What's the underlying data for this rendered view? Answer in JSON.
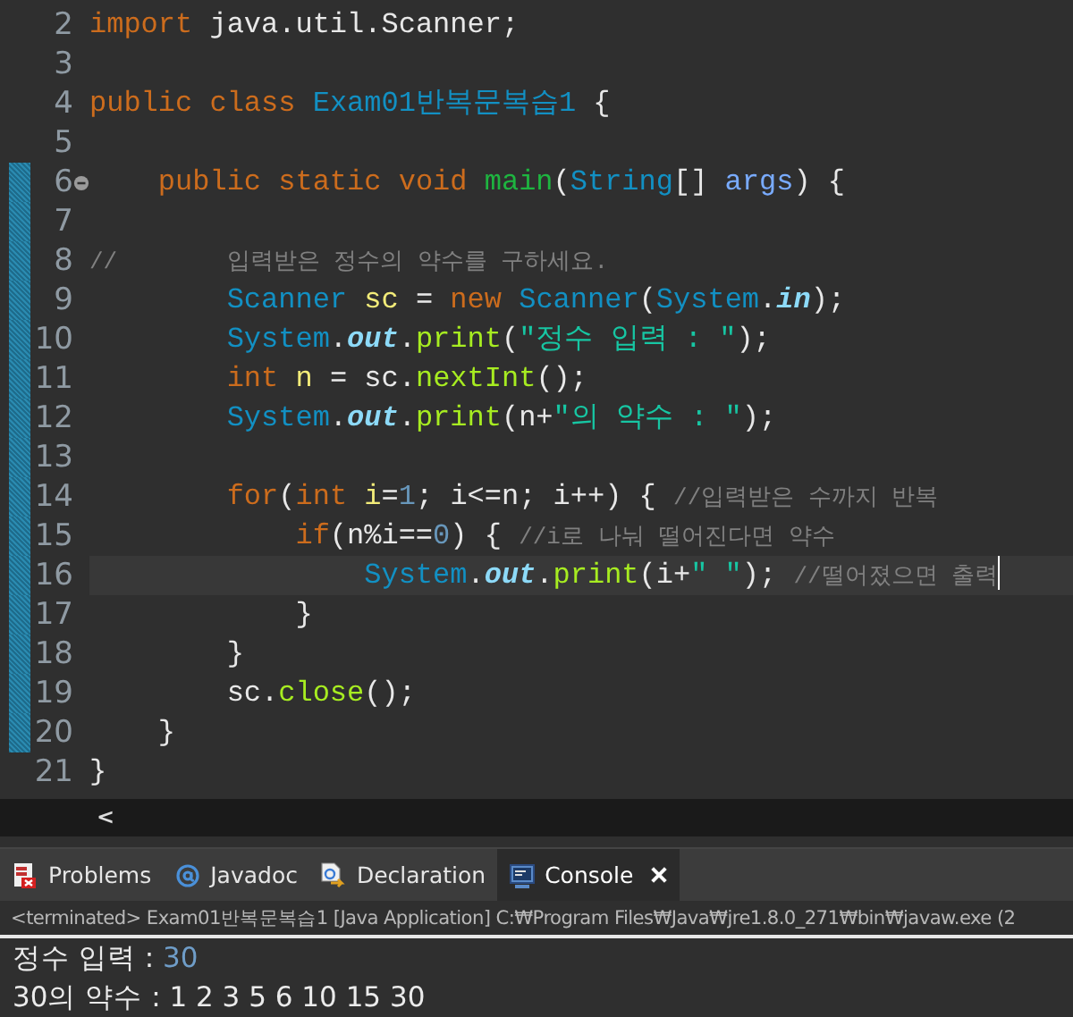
{
  "editor": {
    "lines": [
      {
        "num": "2",
        "changed": false,
        "current": false,
        "fold": false,
        "tokens": [
          {
            "kind": "kw",
            "text": "import"
          },
          {
            "kind": "plain",
            "text": " java.util.Scanner;"
          }
        ]
      },
      {
        "num": "3",
        "changed": false,
        "current": false,
        "fold": false
      },
      {
        "num": "4",
        "changed": false,
        "current": false,
        "fold": false,
        "tokens": [
          {
            "kind": "kw",
            "text": "public "
          },
          {
            "kind": "kw",
            "text": "class "
          },
          {
            "kind": "type",
            "text": "Exam01반복문복습1"
          },
          {
            "kind": "plain",
            "text": " {"
          }
        ]
      },
      {
        "num": "5",
        "changed": false,
        "current": false,
        "fold": false
      },
      {
        "num": "6",
        "changed": true,
        "current": false,
        "fold": true,
        "tokens": [
          {
            "kind": "kw",
            "text": "\tpublic "
          },
          {
            "kind": "kw",
            "text": "static "
          },
          {
            "kind": "kw",
            "text": "void "
          },
          {
            "kind": "decl",
            "text": "main"
          },
          {
            "kind": "plain",
            "text": "("
          },
          {
            "kind": "type",
            "text": "String"
          },
          {
            "kind": "plain",
            "text": "[] "
          },
          {
            "kind": "param",
            "text": "args"
          },
          {
            "kind": "plain",
            "text": ") {"
          }
        ]
      },
      {
        "num": "7",
        "changed": true,
        "current": false,
        "fold": false
      },
      {
        "num": "8",
        "changed": true,
        "current": false,
        "fold": false,
        "tokens": [
          {
            "kind": "comment",
            "text": "//\t\t입력받은 정수의 약수를 구하세요."
          }
        ]
      },
      {
        "num": "9",
        "changed": true,
        "current": false,
        "fold": false,
        "tokens": [
          {
            "kind": "type",
            "text": "\t\tScanner "
          },
          {
            "kind": "var",
            "text": "sc"
          },
          {
            "kind": "plain",
            "text": " = "
          },
          {
            "kind": "kw",
            "text": "new "
          },
          {
            "kind": "type",
            "text": "Scanner"
          },
          {
            "kind": "plain",
            "text": "("
          },
          {
            "kind": "type",
            "text": "System"
          },
          {
            "kind": "plain",
            "text": "."
          },
          {
            "kind": "field",
            "text": "in"
          },
          {
            "kind": "plain",
            "text": ");"
          }
        ]
      },
      {
        "num": "10",
        "changed": true,
        "current": false,
        "fold": false,
        "tokens": [
          {
            "kind": "type",
            "text": "\t\tSystem"
          },
          {
            "kind": "plain",
            "text": "."
          },
          {
            "kind": "field",
            "text": "out"
          },
          {
            "kind": "plain",
            "text": "."
          },
          {
            "kind": "method",
            "text": "print"
          },
          {
            "kind": "plain",
            "text": "("
          },
          {
            "kind": "str",
            "text": "\"정수 입력 : \""
          },
          {
            "kind": "plain",
            "text": ");"
          }
        ]
      },
      {
        "num": "11",
        "changed": true,
        "current": false,
        "fold": false,
        "tokens": [
          {
            "kind": "kw",
            "text": "\t\tint "
          },
          {
            "kind": "var",
            "text": "n"
          },
          {
            "kind": "plain",
            "text": " = sc."
          },
          {
            "kind": "method",
            "text": "nextInt"
          },
          {
            "kind": "plain",
            "text": "();"
          }
        ]
      },
      {
        "num": "12",
        "changed": true,
        "current": false,
        "fold": false,
        "tokens": [
          {
            "kind": "type",
            "text": "\t\tSystem"
          },
          {
            "kind": "plain",
            "text": "."
          },
          {
            "kind": "field",
            "text": "out"
          },
          {
            "kind": "plain",
            "text": "."
          },
          {
            "kind": "method",
            "text": "print"
          },
          {
            "kind": "plain",
            "text": "(n+"
          },
          {
            "kind": "str",
            "text": "\"의 약수 : \""
          },
          {
            "kind": "plain",
            "text": ");"
          }
        ]
      },
      {
        "num": "13",
        "changed": true,
        "current": false,
        "fold": false
      },
      {
        "num": "14",
        "changed": true,
        "current": false,
        "fold": false,
        "tokens": [
          {
            "kind": "kw",
            "text": "\t\tfor"
          },
          {
            "kind": "plain",
            "text": "("
          },
          {
            "kind": "kw",
            "text": "int "
          },
          {
            "kind": "var",
            "text": "i"
          },
          {
            "kind": "plain",
            "text": "="
          },
          {
            "kind": "num",
            "text": "1"
          },
          {
            "kind": "plain",
            "text": "; i<=n; i++) { "
          },
          {
            "kind": "comment",
            "text": "//입력받은 수까지 반복"
          }
        ]
      },
      {
        "num": "15",
        "changed": true,
        "current": false,
        "fold": false,
        "tokens": [
          {
            "kind": "kw",
            "text": "\t\t\tif"
          },
          {
            "kind": "plain",
            "text": "(n%i=="
          },
          {
            "kind": "num",
            "text": "0"
          },
          {
            "kind": "plain",
            "text": ") { "
          },
          {
            "kind": "comment",
            "text": "//i로 나눠 떨어진다면 약수"
          }
        ]
      },
      {
        "num": "16",
        "changed": true,
        "current": true,
        "fold": false,
        "tokens": [
          {
            "kind": "type",
            "text": "\t\t\t\tSystem"
          },
          {
            "kind": "plain",
            "text": "."
          },
          {
            "kind": "field",
            "text": "out"
          },
          {
            "kind": "plain",
            "text": "."
          },
          {
            "kind": "method",
            "text": "print"
          },
          {
            "kind": "plain",
            "text": "(i+"
          },
          {
            "kind": "str",
            "text": "\" \""
          },
          {
            "kind": "plain",
            "text": "); "
          },
          {
            "kind": "comment",
            "text": "//떨어졌으면 출력"
          }
        ]
      },
      {
        "num": "17",
        "changed": true,
        "current": false,
        "fold": false,
        "tokens": [
          {
            "kind": "plain",
            "text": "\t\t\t}"
          }
        ]
      },
      {
        "num": "18",
        "changed": true,
        "current": false,
        "fold": false,
        "tokens": [
          {
            "kind": "plain",
            "text": "\t\t}"
          }
        ]
      },
      {
        "num": "19",
        "changed": true,
        "current": false,
        "fold": false,
        "tokens": [
          {
            "kind": "plain",
            "text": "\t\tsc."
          },
          {
            "kind": "method",
            "text": "close"
          },
          {
            "kind": "plain",
            "text": "();"
          }
        ]
      },
      {
        "num": "20",
        "changed": true,
        "current": false,
        "fold": false,
        "tokens": [
          {
            "kind": "plain",
            "text": "\t}"
          }
        ]
      },
      {
        "num": "21",
        "changed": false,
        "current": false,
        "fold": false,
        "tokens": [
          {
            "kind": "plain",
            "text": "}"
          }
        ]
      }
    ]
  },
  "scroll_left": "<",
  "views": {
    "tabs": [
      {
        "label": "Problems",
        "kind": "problems",
        "selected": false
      },
      {
        "label": "Javadoc",
        "kind": "javadoc",
        "selected": false
      },
      {
        "label": "Declaration",
        "kind": "declaration",
        "selected": false
      },
      {
        "label": "Console",
        "kind": "console",
        "selected": true
      }
    ]
  },
  "console": {
    "header": "<terminated> Exam01반복문복습1 [Java Application] C:₩Program Files₩Java₩jre1.8.0_271₩bin₩javaw.exe  (2",
    "lines": [
      [
        {
          "kind": "out",
          "text": "정수 입력 : "
        },
        {
          "kind": "in",
          "text": "30"
        }
      ],
      [
        {
          "kind": "out",
          "text": "30의 약수 : 1 2 3 5 6 10 15 30"
        }
      ]
    ]
  }
}
